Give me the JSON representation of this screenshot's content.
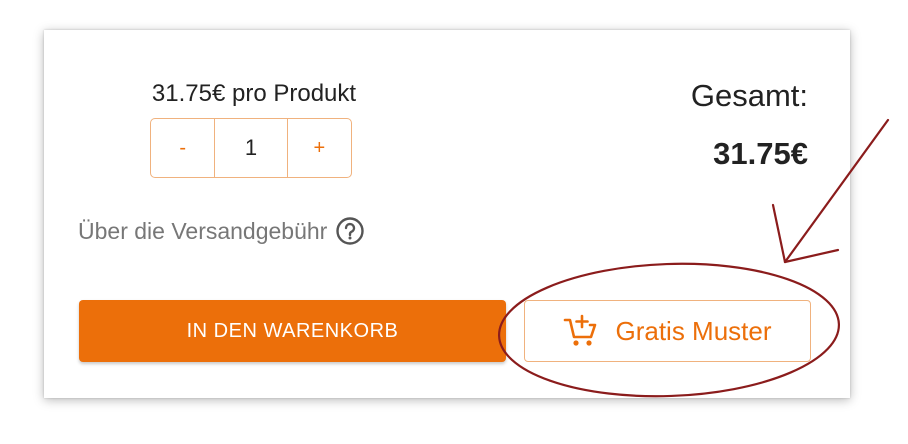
{
  "product": {
    "price_per_unit": "31.75€ pro Produkt"
  },
  "quantity": {
    "minus_label": "-",
    "value": "1",
    "plus_label": "+"
  },
  "shipping": {
    "label": "Über die Versandgebühr",
    "help_icon": "question-circle-icon"
  },
  "total": {
    "label": "Gesamt:",
    "value": "31.75€"
  },
  "buttons": {
    "add_to_cart": "IN DEN WARENKORB",
    "free_sample": "Gratis Muster",
    "free_sample_icon": "cart-plus-icon"
  },
  "colors": {
    "accent": "#ec6f0a",
    "accent_border": "#f0b27e",
    "annotation": "#8b1c1c"
  }
}
